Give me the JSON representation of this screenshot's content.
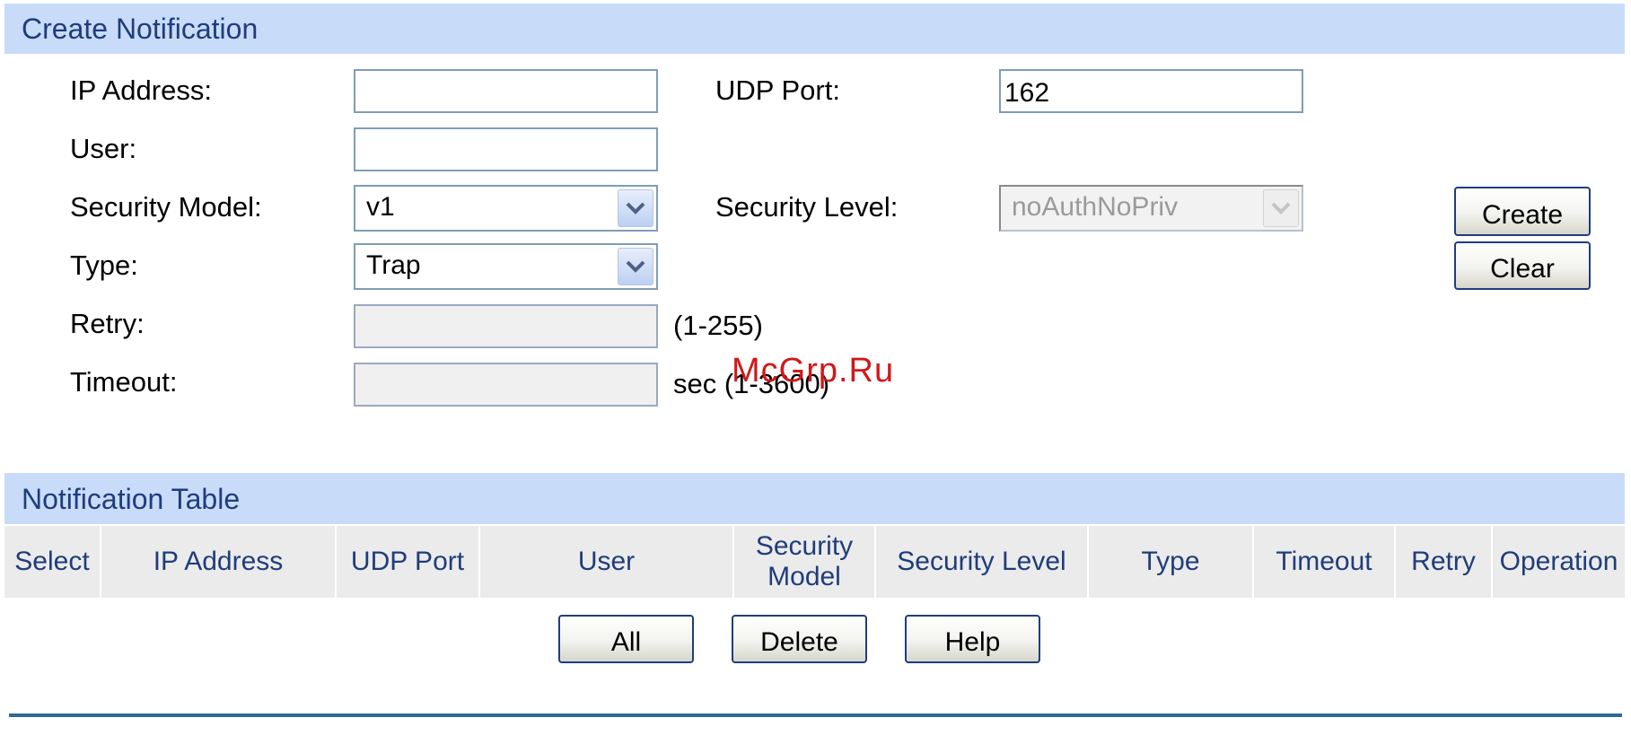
{
  "create_section": {
    "title": "Create Notification",
    "ip_address_label": "IP Address:",
    "ip_address_value": "",
    "udp_port_label": "UDP Port:",
    "udp_port_value": "162",
    "user_label": "User:",
    "user_value": "",
    "security_model_label": "Security Model:",
    "security_model_value": "v1",
    "security_level_label": "Security Level:",
    "security_level_value": "noAuthNoPriv",
    "type_label": "Type:",
    "type_value": "Trap",
    "retry_label": "Retry:",
    "retry_value": "",
    "retry_hint": "(1-255)",
    "timeout_label": "Timeout:",
    "timeout_value": "",
    "timeout_hint": "sec (1-3600)",
    "create_button": "Create",
    "clear_button": "Clear"
  },
  "table_section": {
    "title": "Notification Table",
    "columns": [
      "Select",
      "IP Address",
      "UDP Port",
      "User",
      "Security Model",
      "Security Level",
      "Type",
      "Timeout",
      "Retry",
      "Operation"
    ],
    "rows": [],
    "all_button": "All",
    "delete_button": "Delete",
    "help_button": "Help"
  },
  "watermark": "McGrp.Ru",
  "icons": {
    "dropdown": "chevron-down-icon"
  },
  "colors": {
    "section_header_bg": "#c8dcfa",
    "section_header_text": "#1f3d7a",
    "table_header_bg": "#ebebeb",
    "button_border": "#1f3d7a",
    "rule": "#2f6a96",
    "watermark": "#d01818"
  }
}
